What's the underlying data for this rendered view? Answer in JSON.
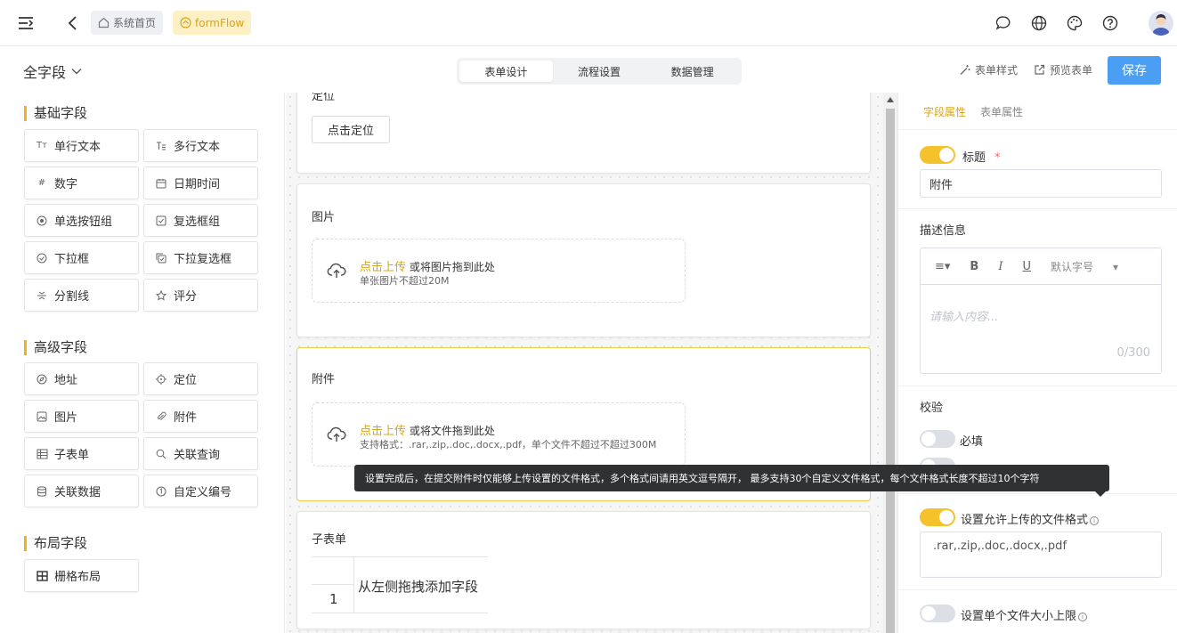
{
  "header": {
    "home_tag": "系统首页",
    "flow_tag": "formFlow"
  },
  "subbar": {
    "all_fields": "全字段",
    "tabs": [
      "表单设计",
      "流程设置",
      "数据管理"
    ],
    "form_style": "表单样式",
    "preview": "预览表单",
    "save": "保存"
  },
  "left": {
    "groups": [
      {
        "title": "基础字段",
        "fields": [
          "单行文本",
          "多行文本",
          "数字",
          "日期时间",
          "单选按钮组",
          "复选框组",
          "下拉框",
          "下拉复选框",
          "分割线",
          "评分"
        ]
      },
      {
        "title": "高级字段",
        "fields": [
          "地址",
          "定位",
          "图片",
          "附件",
          "子表单",
          "关联查询",
          "关联数据",
          "自定义编号"
        ]
      },
      {
        "title": "布局字段",
        "fields": [
          "栅格布局"
        ]
      }
    ]
  },
  "canvas": {
    "location": {
      "label": "定位",
      "button": "点击定位"
    },
    "image": {
      "label": "图片",
      "upload_link": "点击上传",
      "upload_text": "或将图片拖到此处",
      "hint": "单张图片不超过20M"
    },
    "attachment": {
      "label": "附件",
      "upload_link": "点击上传",
      "upload_text": "或将文件拖到此处",
      "hint": "支持格式：.rar,.zip,.doc,.docx,.pdf，单个文件不超过不超过300M"
    },
    "subform": {
      "label": "子表单",
      "row_number": "1",
      "hint": "从左侧拖拽添加字段"
    }
  },
  "tooltip": "设置完成后，在提交附件时仅能够上传设置的文件格式，多个格式间请用英文逗号隔开， 最多支持30个自定义文件格式，每个文件格式长度不超过10个字符",
  "right": {
    "tabs": [
      "字段属性",
      "表单属性"
    ],
    "title_label": "标题",
    "required_mark": "*",
    "title_value": "附件",
    "desc_label": "描述信息",
    "editor_font": "默认字号",
    "editor_placeholder": "请输入内容...",
    "editor_count": "0/300",
    "validate_label": "校验",
    "required_label": "必填",
    "allowed_formats_label": "设置允许上传的文件格式",
    "allowed_formats_value": ".rar,.zip,.doc,.docx,.pdf",
    "size_limit_label": "设置单个文件大小上限"
  },
  "colors": {
    "accent": "#f5c22b",
    "primary": "#4a9ff5",
    "link": "#d8a41a"
  }
}
